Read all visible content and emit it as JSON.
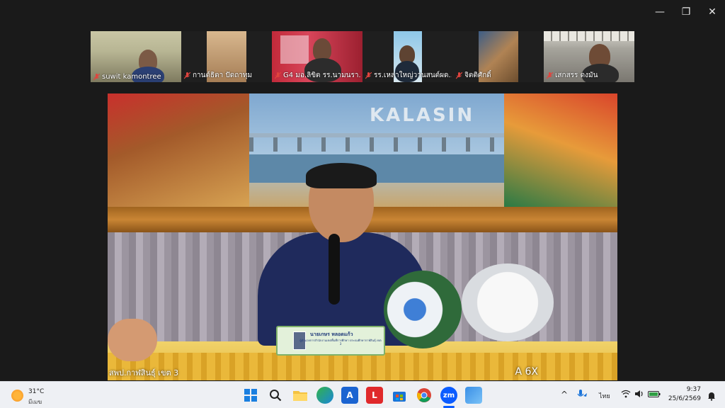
{
  "window_controls": {
    "minimize": "—",
    "maximize": "❐",
    "close": "✕"
  },
  "participants": [
    {
      "name": "suwit kamontree",
      "muted": true
    },
    {
      "name": "กานต์ธิดา  ปัดถาทุม",
      "muted": true
    },
    {
      "name": "G4 มอ.ลิขิต  รร.นามนรา...",
      "muted": true
    },
    {
      "name": "รร.เหล่าใหญ่วานสนต์ผด...",
      "muted": true
    },
    {
      "name": "จิตติศักดิ์",
      "muted": true
    },
    {
      "name": "เสกสรร ดงมัน",
      "muted": true
    }
  ],
  "main_video": {
    "banner_text": "KALASIN",
    "speaker_label": "สพป.กาฬสินธุ์ เขต 3",
    "overlay_right": "A  6X",
    "nameplate_title": "นายเกษร  หลอดแก้ว",
    "nameplate_subtitle": "ผู้อำนวยการสำนักงานเขตพื้นที่การศึกษา ประถมศึกษากาฬสินธุ์ เขต 3"
  },
  "taskbar": {
    "weather_temp": "31°C",
    "weather_condition": "มีเมฆ",
    "apps": [
      {
        "name": "start",
        "glyph": ""
      },
      {
        "name": "search",
        "glyph": ""
      },
      {
        "name": "file-explorer",
        "glyph": ""
      },
      {
        "name": "edge",
        "glyph": ""
      },
      {
        "name": "app-a",
        "glyph": "A"
      },
      {
        "name": "app-l",
        "glyph": "L"
      },
      {
        "name": "store",
        "glyph": ""
      },
      {
        "name": "chrome",
        "glyph": ""
      },
      {
        "name": "zoom",
        "glyph": "zm"
      },
      {
        "name": "app-photo",
        "glyph": ""
      }
    ],
    "tray": {
      "chevron": "^",
      "lang": "ไทย"
    },
    "time": "9:37",
    "date": "25/6/2569"
  },
  "colors": {
    "taskbar_bg": "#eef0f4",
    "zoom_blue": "#0b5cff",
    "muted_red": "#e0443e"
  }
}
